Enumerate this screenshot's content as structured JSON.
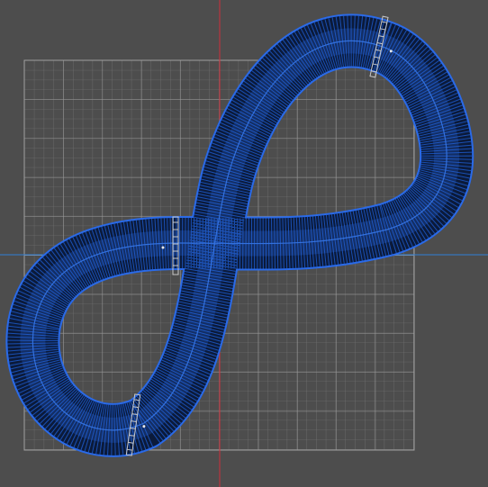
{
  "viewport": {
    "view": "top",
    "background_color": "#4d4d4d",
    "grid_minor_color": "#7a7a7a",
    "grid_major_color": "#9a9a9a",
    "x_axis_color": "#2f7fd8",
    "y_axis_color": "#d0303a"
  },
  "track": {
    "shape": "figure-eight",
    "fill_color": "#0b1a3a",
    "wire_color": "#1e5dd0",
    "outline_color": "#2a6ae8",
    "cross_sections": 4
  },
  "gates": {
    "color": "#c8c8c8"
  }
}
